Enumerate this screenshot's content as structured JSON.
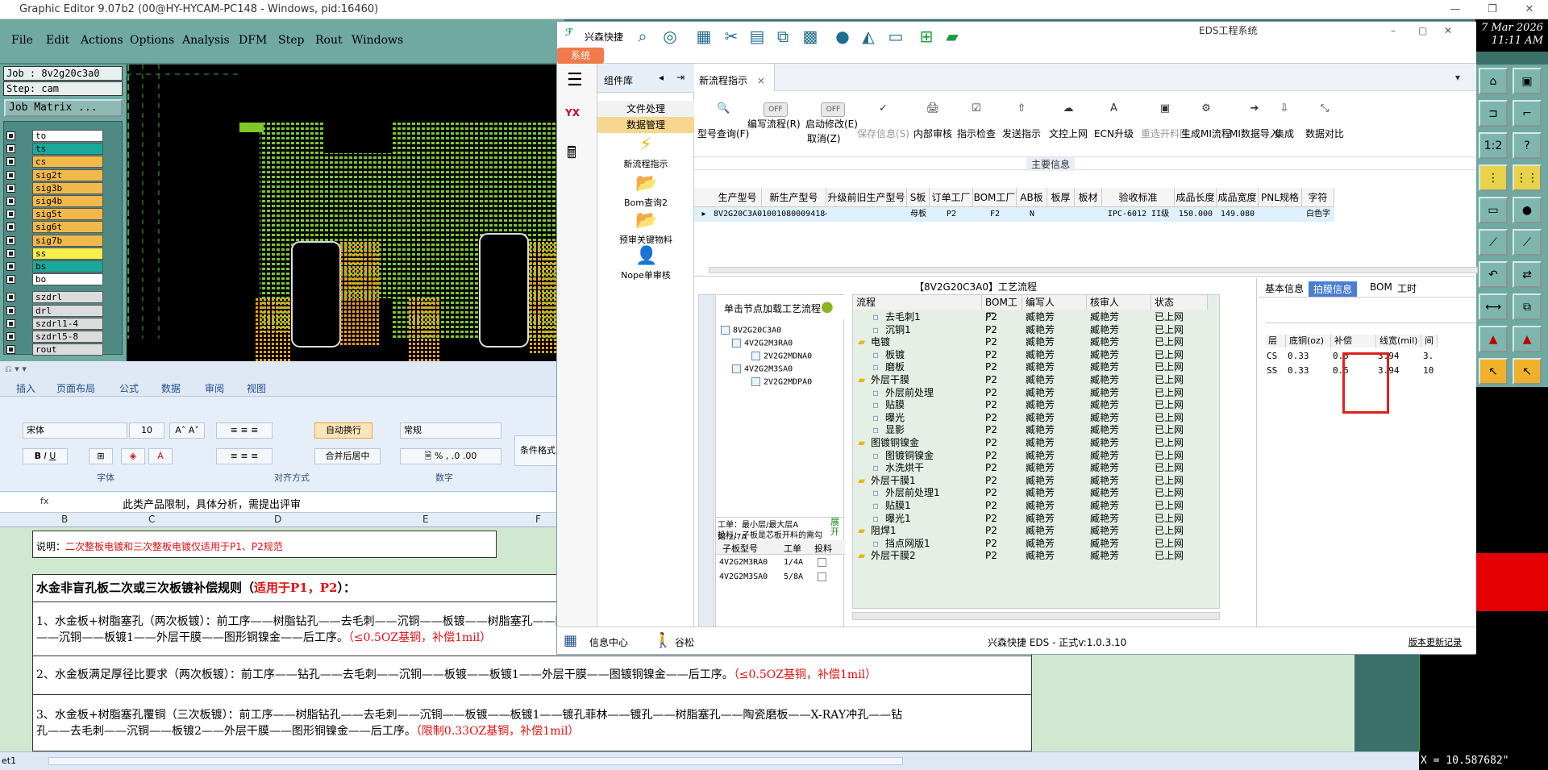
{
  "ge": {
    "title": "Graphic Editor 9.07b2 (00@HY-HYCAM-PC148 - Windows, pid:16460)",
    "menu": [
      "File",
      "Edit",
      "Actions",
      "Options",
      "Analysis",
      "DFM",
      "Step",
      "Rout",
      "Windows"
    ],
    "job": "Job : 8v2g20c3a0",
    "step": "Step: cam",
    "job_matrix": "Job Matrix ...",
    "layers": [
      {
        "name": "to",
        "color": "#ffffff"
      },
      {
        "name": "ts",
        "color": "#19a99a"
      },
      {
        "name": "cs",
        "color": "#f3b84a"
      },
      {
        "name": "sig2t",
        "color": "#f3b84a"
      },
      {
        "name": "sig3b",
        "color": "#f3b84a"
      },
      {
        "name": "sig4b",
        "color": "#f3b84a"
      },
      {
        "name": "sig5t",
        "color": "#f3b84a"
      },
      {
        "name": "sig6t",
        "color": "#f3b84a"
      },
      {
        "name": "sig7b",
        "color": "#f3b84a"
      },
      {
        "name": "ss",
        "color": "#f7ef4a"
      },
      {
        "name": "bs",
        "color": "#19a99a"
      },
      {
        "name": "bo",
        "color": "#ffffff"
      },
      {
        "name": "szdrl",
        "color": "#dcdcdc"
      },
      {
        "name": "drl",
        "color": "#dcdcdc"
      },
      {
        "name": "szdrl1-4",
        "color": "#dcdcdc"
      },
      {
        "name": "szdrl5-8",
        "color": "#dcdcdc"
      },
      {
        "name": "rout",
        "color": "#dcdcdc"
      }
    ],
    "clock_line1": "7 Mar 2026",
    "clock_line2": "11:11 AM",
    "coords": "X = 10.587682\""
  },
  "excel": {
    "tabs": [
      "插入",
      "页面布局",
      "公式",
      "数据",
      "审阅",
      "视图"
    ],
    "font_name": "宋体",
    "font_size": "10",
    "wrap_label": "自动换行",
    "merge_label": "合并后居中",
    "number_format": "常规",
    "cond_format": "条件格式",
    "group_font": "字体",
    "group_align": "对齐方式",
    "group_number": "数字",
    "fx": "fx",
    "formula": "此类产品限制，具体分析，需提出评审",
    "cols": [
      "B",
      "C",
      "D",
      "E",
      "F"
    ],
    "note_label": "说明：",
    "note_text": "二次整板电镀和三次整板电镀仅适用于P1、P2规范",
    "heading": "水金非盲孔板二次或三次板镀补偿规则（",
    "heading_red": "适用于P1，P2",
    "heading_end": "）：",
    "rule1": "1、水金板+树脂塞孔（两次板镀）：前工序——树脂钻孔——去毛刺——沉铜——板镀——树脂塞孔——陶瓷磨板——X-RAY冲孔——钻孔——去毛刺",
    "rule1b": "——沉铜——板镀1——外层干膜——图形铜镍金——后工序。",
    "rule1_red": "（≤0.5OZ基铜，补偿1mil）",
    "rule2": "2、水金板满足厚径比要求（两次板镀）：前工序——钻孔——去毛刺——沉铜——板镀——板镀1——外层干膜——图镀铜镍金——后工序。",
    "rule2_red": "（≤0.5OZ基铜，补偿1mil）",
    "rule3": "3、水金板+树脂塞孔覆铜（三次板镀）：前工序——树脂钻孔——去毛刺——沉铜——板镀——板镀1——镀孔菲林——镀孔——树脂塞孔——陶瓷磨板——X-RAY冲孔——钻",
    "rule3b": "孔——去毛刺——沉铜——板镀2——外层干膜——图形铜镍金——后工序。",
    "rule3_red": "（限制0.33OZ基铜，补偿1mil）",
    "sheet_tab": "et1"
  },
  "eds": {
    "brand": "兴森快捷",
    "title": "EDS工程系统",
    "system_tab": "系统",
    "comp_title": "组件库",
    "btn_file": "文件处理",
    "btn_data": "数据管理",
    "comp_items": [
      "新流程指示",
      "Bom查询2",
      "预审关键物料",
      "Nope单审核"
    ],
    "tab_label": "新流程指示",
    "tools": [
      {
        "label": "型号查询(F)",
        "icon": "🔍"
      },
      {
        "label": "编写流程(R)",
        "icon": "OFF"
      },
      {
        "label": "启动修改(E)",
        "icon": "OFF"
      },
      {
        "label": "保存信息(S)",
        "icon": "✓"
      },
      {
        "label": "内部审核",
        "icon": "🖨"
      },
      {
        "label": "指示检查",
        "icon": "☑"
      },
      {
        "label": "发送指示",
        "icon": "⇧"
      },
      {
        "label": "文控上网",
        "icon": "☁"
      },
      {
        "label": "ECN升级",
        "icon": "A"
      },
      {
        "label": "重选开料图",
        "icon": "▣"
      },
      {
        "label": "生成MI流程",
        "icon": "⚙"
      },
      {
        "label": "MI数据导入",
        "icon": "➔"
      },
      {
        "label": "集成",
        "icon": "⇩"
      },
      {
        "label": "数据对比",
        "icon": "⤡"
      }
    ],
    "cancel_label": "取消(Z)",
    "main_info": "主要信息",
    "grid_headers": [
      "生产型号",
      "新生产型号",
      "升级前旧生产型号",
      "S板",
      "订单工厂",
      "BOM工厂",
      "AB板",
      "板厚",
      "板材",
      "验收标准",
      "成品长度",
      "成品宽度",
      "PNL规格",
      "字符"
    ],
    "grid_row": [
      "8V2G20C3A0",
      "10010800094184",
      "",
      "母板",
      "P2",
      "F2",
      "N",
      "",
      "",
      "IPC-6012 II级",
      "150.000",
      "149.080",
      "",
      "白色字"
    ],
    "flow_title": "【8V2G20C3A0】工艺流程",
    "tree_hdr": "单击节点加载工艺流程",
    "tree_nodes": [
      "8V2G20C3A0",
      "4V2G2M3RA0",
      "2V2G2MDNA0",
      "4V2G2M3SA0",
      "2V2G2MDPA0"
    ],
    "tree_note1": "工单：最小层/最大层A 如:2/7A",
    "tree_note2": "投料：子板是芯板开料的需勾选",
    "expand": "展开",
    "sub_hdr": [
      "子板型号",
      "工单",
      "投料"
    ],
    "sub_rows": [
      [
        "4V2G2M3RA0",
        "1/4A"
      ],
      [
        "4V2G2M3SA0",
        "5/8A"
      ]
    ],
    "flow_headers": [
      "流程",
      "BOM工厂",
      "编写人",
      "核审人",
      "状态"
    ],
    "flow_rows": [
      {
        "name": "去毛刺1",
        "f": "P2",
        "w": "臧艳芳",
        "r": "臧艳芳",
        "s": "已上网",
        "lvl": 2
      },
      {
        "name": "沉铜1",
        "f": "P2",
        "w": "臧艳芳",
        "r": "臧艳芳",
        "s": "已上网",
        "lvl": 2
      },
      {
        "name": "电镀",
        "f": "P2",
        "w": "臧艳芳",
        "r": "臧艳芳",
        "s": "已上网",
        "lvl": 1
      },
      {
        "name": "板镀",
        "f": "P2",
        "w": "臧艳芳",
        "r": "臧艳芳",
        "s": "已上网",
        "lvl": 2
      },
      {
        "name": "磨板",
        "f": "P2",
        "w": "臧艳芳",
        "r": "臧艳芳",
        "s": "已上网",
        "lvl": 2
      },
      {
        "name": "外层干膜",
        "f": "P2",
        "w": "臧艳芳",
        "r": "臧艳芳",
        "s": "已上网",
        "lvl": 1
      },
      {
        "name": "外层前处理",
        "f": "P2",
        "w": "臧艳芳",
        "r": "臧艳芳",
        "s": "已上网",
        "lvl": 2
      },
      {
        "name": "贴膜",
        "f": "P2",
        "w": "臧艳芳",
        "r": "臧艳芳",
        "s": "已上网",
        "lvl": 2
      },
      {
        "name": "曝光",
        "f": "P2",
        "w": "臧艳芳",
        "r": "臧艳芳",
        "s": "已上网",
        "lvl": 2
      },
      {
        "name": "显影",
        "f": "P2",
        "w": "臧艳芳",
        "r": "臧艳芳",
        "s": "已上网",
        "lvl": 2
      },
      {
        "name": "图镀铜镍金",
        "f": "P2",
        "w": "臧艳芳",
        "r": "臧艳芳",
        "s": "已上网",
        "lvl": 1
      },
      {
        "name": "图镀铜镍金",
        "f": "P2",
        "w": "臧艳芳",
        "r": "臧艳芳",
        "s": "已上网",
        "lvl": 2
      },
      {
        "name": "水洗烘干",
        "f": "P2",
        "w": "臧艳芳",
        "r": "臧艳芳",
        "s": "已上网",
        "lvl": 2
      },
      {
        "name": "外层干膜1",
        "f": "P2",
        "w": "臧艳芳",
        "r": "臧艳芳",
        "s": "已上网",
        "lvl": 1
      },
      {
        "name": "外层前处理1",
        "f": "P2",
        "w": "臧艳芳",
        "r": "臧艳芳",
        "s": "已上网",
        "lvl": 2
      },
      {
        "name": "贴膜1",
        "f": "P2",
        "w": "臧艳芳",
        "r": "臧艳芳",
        "s": "已上网",
        "lvl": 2
      },
      {
        "name": "曝光1",
        "f": "P2",
        "w": "臧艳芳",
        "r": "臧艳芳",
        "s": "已上网",
        "lvl": 2
      },
      {
        "name": "阻焊1",
        "f": "P2",
        "w": "臧艳芳",
        "r": "臧艳芳",
        "s": "已上网",
        "lvl": 1
      },
      {
        "name": "挡点网版1",
        "f": "P2",
        "w": "臧艳芳",
        "r": "臧艳芳",
        "s": "已上网",
        "lvl": 2
      },
      {
        "name": "外层干膜2",
        "f": "P2",
        "w": "臧艳芳",
        "r": "臧艳芳",
        "s": "已上网",
        "lvl": 1
      }
    ],
    "info_tabs": [
      "基本信息",
      "拍膜信息",
      "BOM",
      "工时"
    ],
    "info_headers": [
      "层",
      "底铜(oz)",
      "补偿",
      "线宽(mil)",
      "间"
    ],
    "info_rows": [
      [
        "CS",
        "0.33",
        "0.5",
        "3.94",
        "3."
      ],
      [
        "SS",
        "0.33",
        "0.5",
        "3.94",
        "10"
      ]
    ],
    "status_info": "信息中心",
    "status_user": "谷松",
    "status_version": "兴森快捷 EDS - 正式v:1.0.3.10",
    "status_log": "版本更新记录"
  }
}
